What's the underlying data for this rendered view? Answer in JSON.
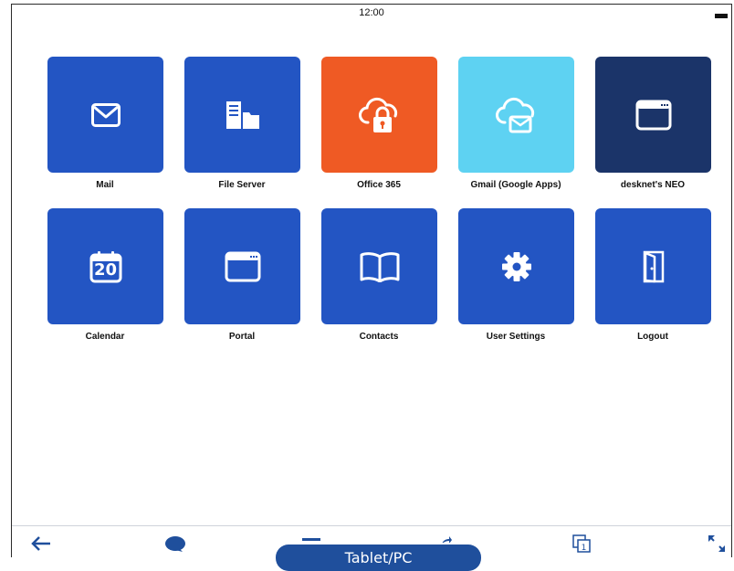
{
  "status": {
    "time": "12:00"
  },
  "tiles": [
    {
      "label": "Mail",
      "icon": "mail-icon",
      "color": "#2355c3"
    },
    {
      "label": "File Server",
      "icon": "file-server-icon",
      "color": "#2355c3"
    },
    {
      "label": "Office 365",
      "icon": "cloud-lock-icon",
      "color": "#ef5a24"
    },
    {
      "label": "Gmail (Google Apps)",
      "icon": "cloud-mail-icon",
      "color": "#5ed2f2"
    },
    {
      "label": "desknet's NEO",
      "icon": "browser-window-icon",
      "color": "#1b3469"
    },
    {
      "label": "Calendar",
      "icon": "calendar-icon",
      "color": "#2355c3",
      "calendar_day": "20"
    },
    {
      "label": "Portal",
      "icon": "browser-window-icon",
      "color": "#2355c3"
    },
    {
      "label": "Contacts",
      "icon": "book-icon",
      "color": "#2355c3"
    },
    {
      "label": "User Settings",
      "icon": "gear-icon",
      "color": "#2355c3"
    },
    {
      "label": "Logout",
      "icon": "door-icon",
      "color": "#2355c3"
    }
  ],
  "toolbar": {
    "items": [
      "back-arrow-icon",
      "chat-bubble-icon",
      "minus-icon",
      "forward-arrow-icon",
      "page-copy-icon",
      "expand-icon"
    ],
    "accent": "#1f4f9c"
  },
  "device_label": "Tablet/PC"
}
